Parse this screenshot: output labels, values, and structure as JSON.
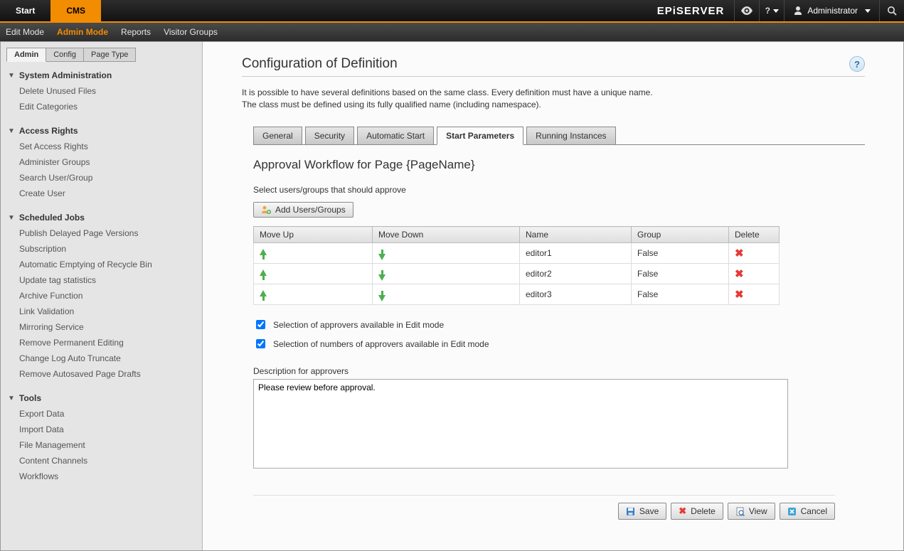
{
  "header": {
    "start_label": "Start",
    "cms_label": "CMS",
    "logo_text": "EPiSERVER",
    "user_label": "Administrator"
  },
  "mode_menu": {
    "items": [
      "Edit Mode",
      "Admin Mode",
      "Reports",
      "Visitor Groups"
    ],
    "active_index": 1
  },
  "sidebar_tabs": {
    "items": [
      "Admin",
      "Config",
      "Page Type"
    ],
    "active_index": 0
  },
  "sidebar": [
    {
      "title": "System Administration",
      "items": [
        "Delete Unused Files",
        "Edit Categories"
      ]
    },
    {
      "title": "Access Rights",
      "items": [
        "Set Access Rights",
        "Administer Groups",
        "Search User/Group",
        "Create User"
      ]
    },
    {
      "title": "Scheduled Jobs",
      "items": [
        "Publish Delayed Page Versions",
        "Subscription",
        "Automatic Emptying of Recycle Bin",
        "Update tag statistics",
        "Archive Function",
        "Link Validation",
        "Mirroring Service",
        "Remove Permanent Editing",
        "Change Log Auto Truncate",
        "Remove Autosaved Page Drafts"
      ]
    },
    {
      "title": "Tools",
      "items": [
        "Export Data",
        "Import Data",
        "File Management",
        "Content Channels",
        "Workflows"
      ]
    }
  ],
  "main": {
    "title": "Configuration of Definition",
    "description_line1": "It is possible to have several definitions based on the same class. Every definition must have a unique name.",
    "description_line2": "The class must be defined using its fully qualified name (including namespace).",
    "inner_tabs": {
      "items": [
        "General",
        "Security",
        "Automatic Start",
        "Start Parameters",
        "Running Instances"
      ],
      "active_index": 3
    },
    "panel": {
      "heading": "Approval Workflow for Page {PageName}",
      "select_label": "Select users/groups that should approve",
      "add_button": "Add Users/Groups",
      "table": {
        "headers": [
          "Move Up",
          "Move Down",
          "Name",
          "Group",
          "Delete"
        ],
        "rows": [
          {
            "name": "editor1",
            "group": "False"
          },
          {
            "name": "editor2",
            "group": "False"
          },
          {
            "name": "editor3",
            "group": "False"
          }
        ]
      },
      "check1_label": "Selection of approvers available in Edit mode",
      "check2_label": "Selection of numbers of approvers available in Edit mode",
      "desc_label": "Description for approvers",
      "desc_value": "Please review before approval."
    },
    "footer": {
      "save": "Save",
      "delete": "Delete",
      "view": "View",
      "cancel": "Cancel"
    }
  }
}
